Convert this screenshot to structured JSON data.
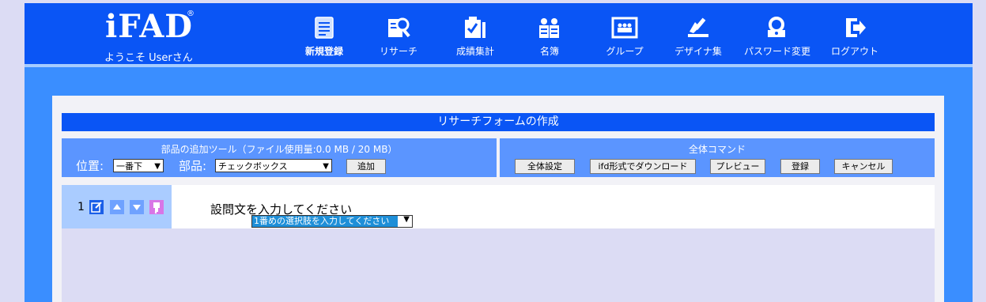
{
  "header": {
    "logo": "iFAD",
    "logo_mark": "®",
    "welcome": "ようこそ Userさん",
    "nav": [
      {
        "label": "新規登録",
        "icon": "new-document-icon",
        "active": true
      },
      {
        "label": "リサーチ",
        "icon": "research-icon",
        "active": false
      },
      {
        "label": "成績集計",
        "icon": "grade-tally-icon",
        "active": false
      },
      {
        "label": "名簿",
        "icon": "roster-icon",
        "active": false
      },
      {
        "label": "グループ",
        "icon": "group-icon",
        "active": false
      },
      {
        "label": "デザイナ集",
        "icon": "designer-icon",
        "active": false
      },
      {
        "label": "パスワード変更",
        "icon": "password-change-icon",
        "active": false
      },
      {
        "label": "ログアウト",
        "icon": "logout-icon",
        "active": false
      }
    ]
  },
  "form": {
    "title": "リサーチフォームの作成",
    "tools": {
      "title": "部品の追加ツール（ファイル使用量:0.0 MB / 20 MB）",
      "position_label": "位置:",
      "position_value": "一番下",
      "part_label": "部品:",
      "part_value": "チェックボックス",
      "add_button": "追加"
    },
    "commands": {
      "title": "全体コマンド",
      "buttons": [
        "全体設定",
        "ifd形式でダウンロード",
        "プレビュー",
        "登録",
        "キャンセル"
      ]
    },
    "question": {
      "number": "1",
      "text": "設問文を入力してください",
      "choice_value": "1番めの選択肢を入力してください",
      "icons": [
        "edit-icon",
        "move-up-icon",
        "move-down-icon",
        "delete-icon"
      ]
    }
  },
  "colors": {
    "header_bg": "#0a55f5",
    "frame_bg": "#3a8eff",
    "tool_box_bg": "#5b95ff",
    "question_left_bg": "#aaccff",
    "page_bg": "#dcdcf4"
  }
}
